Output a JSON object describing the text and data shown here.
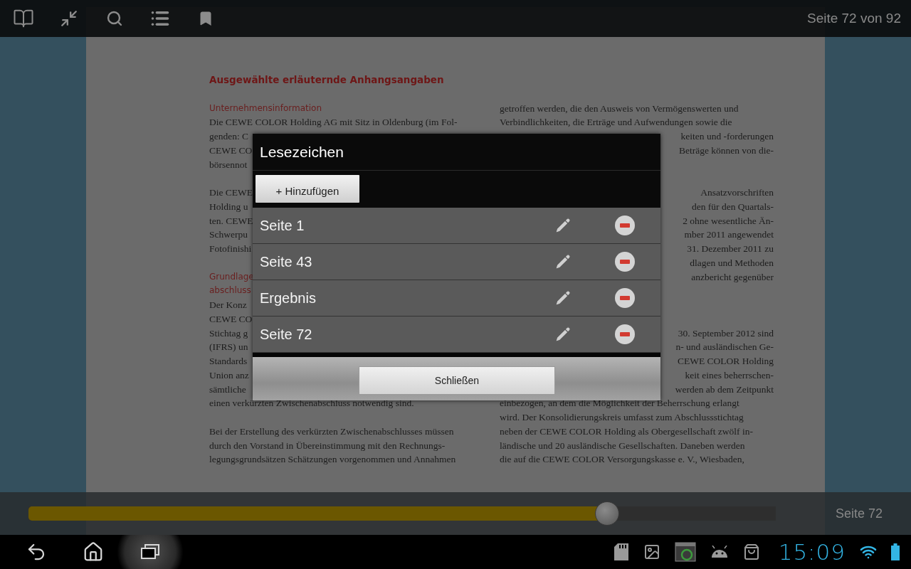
{
  "toolbar": {
    "page_indicator": "Seite 72 von 92"
  },
  "document": {
    "columns": [
      {
        "lines": [
          {
            "kind": "title",
            "text": "Ausgewählte erläuternde Anhangsangaben"
          },
          {
            "kind": "gap"
          },
          {
            "kind": "heading",
            "text": "Unternehmensinformation"
          },
          {
            "kind": "text",
            "text": "Die CEWE COLOR Holding AG mit Sitz in Oldenburg (im Fol-"
          },
          {
            "kind": "text",
            "text": "genden: C"
          },
          {
            "kind": "text",
            "text": "CEWE CO"
          },
          {
            "kind": "text",
            "text": "börsennot"
          },
          {
            "kind": "gap"
          },
          {
            "kind": "text",
            "text": "Die CEWE"
          },
          {
            "kind": "text",
            "text": "Holding u"
          },
          {
            "kind": "text",
            "text": "ten. CEWE"
          },
          {
            "kind": "text",
            "text": "Schwerpu"
          },
          {
            "kind": "text",
            "text": "Fotofinishi"
          },
          {
            "kind": "gap"
          },
          {
            "kind": "heading",
            "text": "Grundlage"
          },
          {
            "kind": "heading",
            "text": "abschluss"
          },
          {
            "kind": "text",
            "text": "Der Konz"
          },
          {
            "kind": "text",
            "text": "CEWE CO"
          },
          {
            "kind": "text",
            "text": "Stichtag g"
          },
          {
            "kind": "text",
            "text": "(IFRS) un"
          },
          {
            "kind": "text",
            "text": "Standards"
          },
          {
            "kind": "text",
            "text": "Union anz"
          },
          {
            "kind": "text",
            "text": "sämtliche"
          },
          {
            "kind": "text",
            "text": "einen verkürzten Zwischenabschluss notwendig sind."
          },
          {
            "kind": "gap"
          },
          {
            "kind": "text",
            "text": "Bei der Erstellung des verkürzten Zwischenabschlusses müssen"
          },
          {
            "kind": "text",
            "text": "durch den Vorstand in Übereinstimmung mit den Rechnungs-"
          },
          {
            "kind": "text",
            "text": "legungsgrundsätzen Schätzungen vorgenommen und Annahmen"
          }
        ]
      },
      {
        "lines": [
          {
            "kind": "gap"
          },
          {
            "kind": "gap"
          },
          {
            "kind": "text",
            "text": "getroffen werden, die den Ausweis von Vermögenswerten und"
          },
          {
            "kind": "text",
            "text": "Verbindlichkeiten, die Erträge und Aufwendungen sowie die"
          },
          {
            "kind": "tail",
            "text": "keiten und -forderungen"
          },
          {
            "kind": "tail",
            "text": "Beträge können von die-"
          },
          {
            "kind": "gap"
          },
          {
            "kind": "gap"
          },
          {
            "kind": "tail",
            "text": "Ansatzvorschriften"
          },
          {
            "kind": "tail",
            "text": "den für den Quartals-"
          },
          {
            "kind": "tail",
            "text": "2 ohne wesentliche Än-"
          },
          {
            "kind": "tail",
            "text": "mber 2011 angewendet"
          },
          {
            "kind": "tail",
            "text": "31. Dezember 2011 zu"
          },
          {
            "kind": "tail",
            "text": "dlagen und Methoden"
          },
          {
            "kind": "tail",
            "text": "anzbericht gegenüber"
          },
          {
            "kind": "gap"
          },
          {
            "kind": "gap"
          },
          {
            "kind": "gap"
          },
          {
            "kind": "tail",
            "text": "30. September 2012 sind"
          },
          {
            "kind": "tail",
            "text": "n- und ausländischen Ge-"
          },
          {
            "kind": "tail",
            "text": "CEWE COLOR Holding"
          },
          {
            "kind": "tail",
            "text": "keit eines beherrschen-"
          },
          {
            "kind": "tail",
            "text": "werden ab dem Zeitpunkt"
          },
          {
            "kind": "text",
            "text": "einbezogen, an dem die Möglichkeit der Beherrschung erlangt"
          },
          {
            "kind": "text",
            "text": "wird. Der Konsolidierungskreis umfasst zum Abschlussstichtag"
          },
          {
            "kind": "text",
            "text": "neben der CEWE COLOR Holding als Obergesellschaft zwölf in-"
          },
          {
            "kind": "text",
            "text": "ländische und 20 ausländische Gesellschaften. Daneben werden"
          },
          {
            "kind": "text",
            "text": "die auf die CEWE COLOR Versorgungskasse e. V., Wiesbaden,"
          }
        ]
      }
    ]
  },
  "dialog": {
    "title": "Lesezeichen",
    "add_button": "+ Hinzufügen",
    "bookmarks": [
      {
        "label": "Seite 1"
      },
      {
        "label": "Seite 43"
      },
      {
        "label": "Ergebnis"
      },
      {
        "label": "Seite 72"
      }
    ],
    "close_button": "Schließen"
  },
  "slider": {
    "level": 0.774,
    "label": "Seite 72"
  },
  "nav": [
    {
      "kind": "back",
      "pressed": false
    },
    {
      "kind": "home",
      "pressed": false
    },
    {
      "kind": "recents",
      "pressed": true
    }
  ],
  "status_bar": {
    "time": "15:09"
  }
}
